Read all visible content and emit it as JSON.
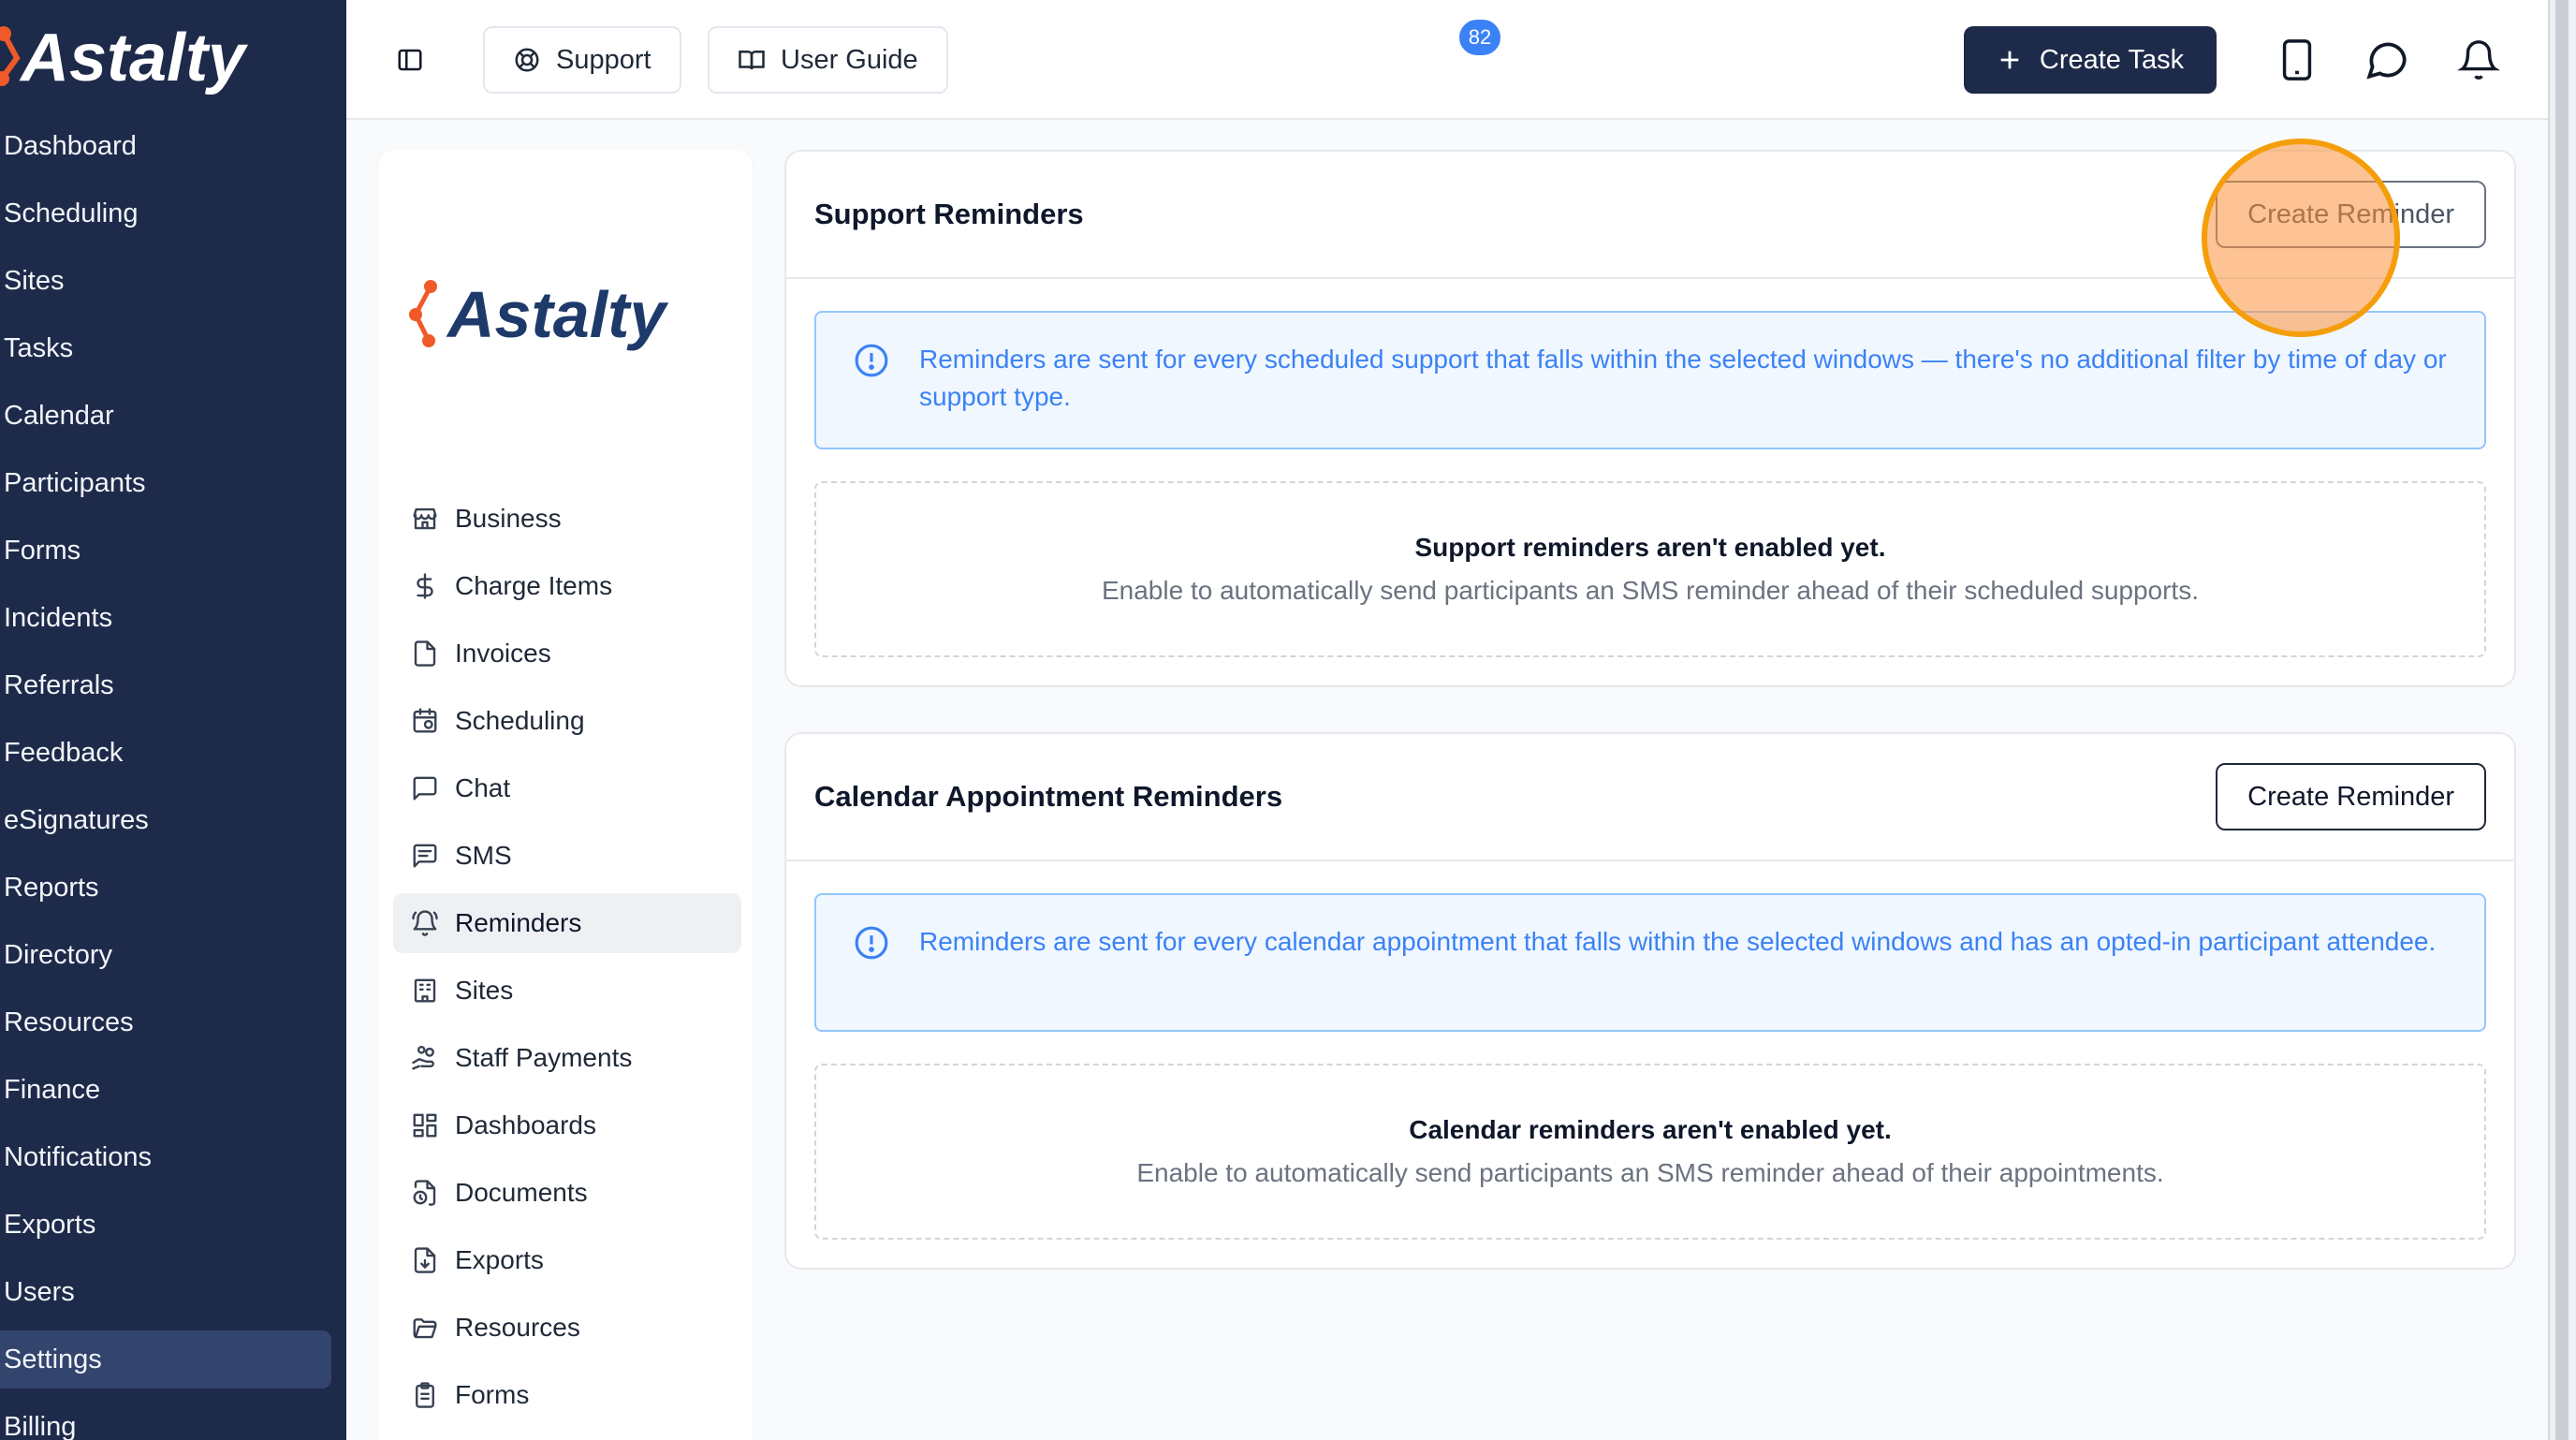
{
  "brand": {
    "name": "Astalty",
    "colors": {
      "navy": "#1e2a4a",
      "orange": "#f05a28",
      "blue": "#3b82f6"
    }
  },
  "sidebar": {
    "items": [
      {
        "label": "Dashboard"
      },
      {
        "label": "Scheduling"
      },
      {
        "label": "Sites"
      },
      {
        "label": "Tasks"
      },
      {
        "label": "Calendar"
      },
      {
        "label": "Participants"
      },
      {
        "label": "Forms"
      },
      {
        "label": "Incidents"
      },
      {
        "label": "Referrals"
      },
      {
        "label": "Feedback"
      },
      {
        "label": "eSignatures"
      },
      {
        "label": "Reports"
      },
      {
        "label": "Directory"
      },
      {
        "label": "Resources"
      },
      {
        "label": "Finance"
      },
      {
        "label": "Notifications"
      },
      {
        "label": "Exports"
      },
      {
        "label": "Users"
      },
      {
        "label": "Settings",
        "active": true
      },
      {
        "label": "Billing"
      }
    ]
  },
  "header": {
    "toggle_icon": "sidebar-toggle-icon",
    "support_label": "Support",
    "user_guide_label": "User Guide",
    "create_task_label": "Create Task",
    "chat_badge": "82",
    "icons": [
      "phone-icon",
      "chat-icon",
      "bell-icon"
    ]
  },
  "settings_menu": {
    "items": [
      {
        "label": "Business",
        "icon": "store-icon"
      },
      {
        "label": "Charge Items",
        "icon": "dollar-icon"
      },
      {
        "label": "Invoices",
        "icon": "file-icon"
      },
      {
        "label": "Scheduling",
        "icon": "calendar-clock-icon"
      },
      {
        "label": "Chat",
        "icon": "message-icon"
      },
      {
        "label": "SMS",
        "icon": "sms-icon"
      },
      {
        "label": "Reminders",
        "icon": "bell-ring-icon",
        "active": true
      },
      {
        "label": "Sites",
        "icon": "building-icon"
      },
      {
        "label": "Staff Payments",
        "icon": "hand-coins-icon"
      },
      {
        "label": "Dashboards",
        "icon": "layout-dashboard-icon"
      },
      {
        "label": "Documents",
        "icon": "file-clock-icon"
      },
      {
        "label": "Exports",
        "icon": "file-down-icon"
      },
      {
        "label": "Resources",
        "icon": "folder-open-icon"
      },
      {
        "label": "Forms",
        "icon": "clipboard-list-icon"
      }
    ]
  },
  "support_reminders": {
    "title": "Support Reminders",
    "button": "Create Reminder",
    "info": "Reminders are sent for every scheduled support that falls within the selected windows — there's no additional filter by time of day or support type.",
    "empty_title": "Support reminders aren't enabled yet.",
    "empty_sub": "Enable to automatically send participants an SMS reminder ahead of their scheduled supports."
  },
  "calendar_reminders": {
    "title": "Calendar Appointment Reminders",
    "button": "Create Reminder",
    "info": "Reminders are sent for every calendar appointment that falls within the selected windows and has an opted-in participant attendee.",
    "empty_title": "Calendar reminders aren't enabled yet.",
    "empty_sub": "Enable to automatically send participants an SMS reminder ahead of their appointments."
  }
}
